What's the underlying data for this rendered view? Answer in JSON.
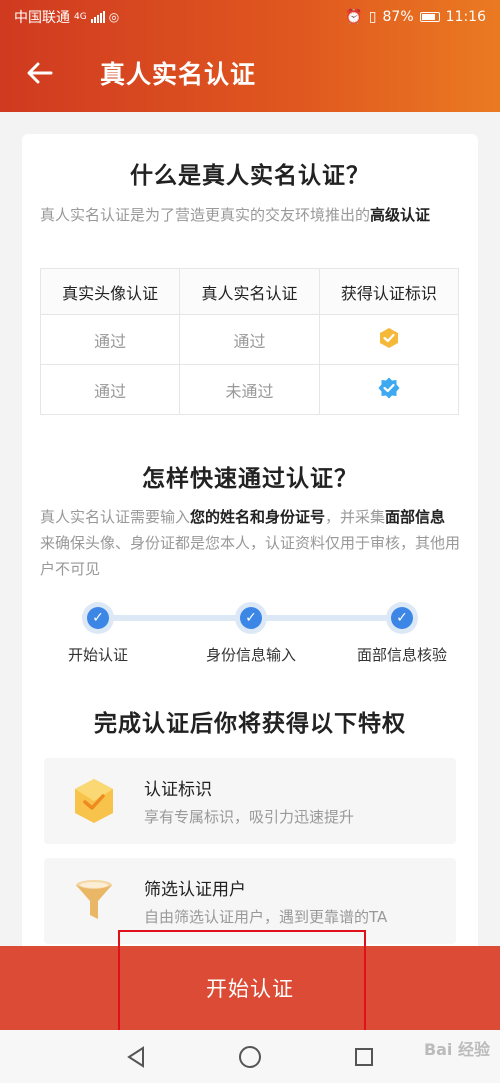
{
  "status": {
    "carrier": "中国联通",
    "network": "4G",
    "battery": "87%",
    "time": "11:16"
  },
  "header": {
    "back_icon": "arrow-left-icon",
    "title": "真人实名认证"
  },
  "section1": {
    "title": "什么是真人实名认证？",
    "desc_plain": "真人实名认证是为了营造更真实的交友环境推出的",
    "desc_bold": "高级认证"
  },
  "table": {
    "headers": [
      "真实头像认证",
      "真人实名认证",
      "获得认证标识"
    ],
    "rows": [
      {
        "avatar": "通过",
        "realname": "通过",
        "badge": "gold-badge-icon"
      },
      {
        "avatar": "通过",
        "realname": "未通过",
        "badge": "blue-badge-icon"
      }
    ]
  },
  "section2": {
    "title": "怎样快速通过认证？",
    "desc_1": "真人实名认证需要输入",
    "desc_b1": "您的姓名和身份证号",
    "desc_2": "，并采集",
    "desc_b2": "面部信息",
    "desc_3": "来确保头像、身份证都是您本人，认证资料仅用于审核，其他用户不可见"
  },
  "steps": [
    {
      "label": "开始认证"
    },
    {
      "label": "身份信息输入"
    },
    {
      "label": "面部信息核验"
    }
  ],
  "section3": {
    "title": "完成认证后你将获得以下特权"
  },
  "perks": [
    {
      "icon": "hexagon-check-icon",
      "title": "认证标识",
      "desc": "享有专属标识，吸引力迅速提升"
    },
    {
      "icon": "funnel-icon",
      "title": "筛选认证用户",
      "desc": "自由筛选认证用户，遇到更靠谱的TA"
    }
  ],
  "cta": {
    "label": "开始认证"
  },
  "watermark": "Bai 经验",
  "colors": {
    "accent": "#dc4b35",
    "blue": "#3c87e6",
    "gold": "#f5b93a"
  }
}
